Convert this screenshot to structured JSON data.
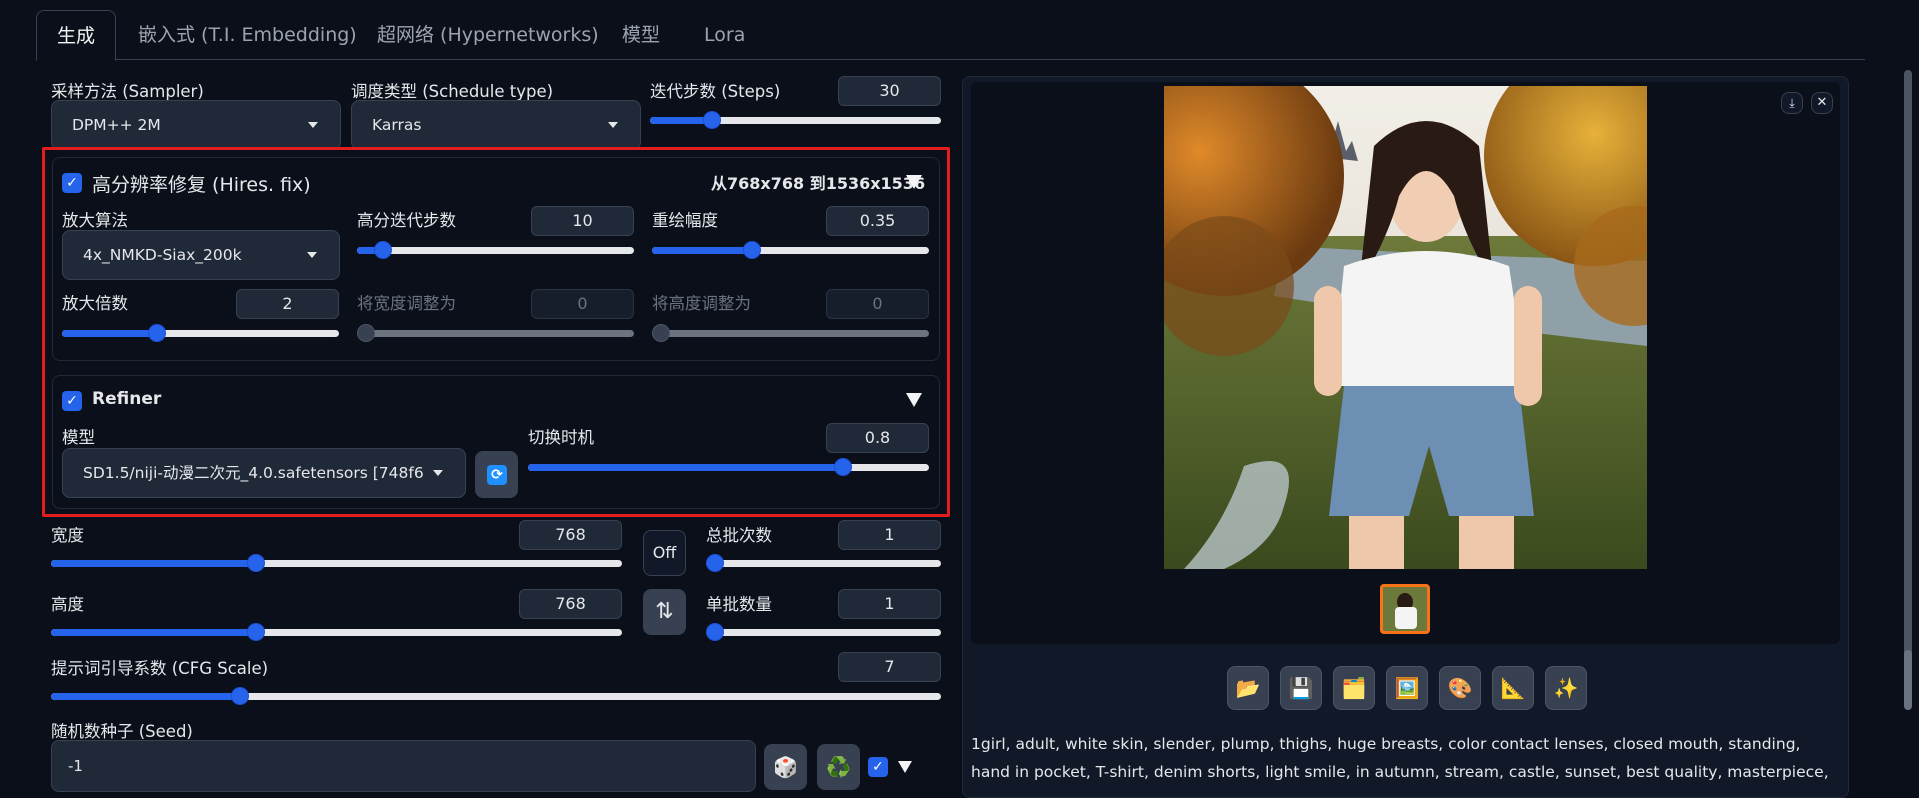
{
  "tabs": [
    {
      "label": "生成",
      "selected": true
    },
    {
      "label": "嵌入式 (T.I. Embedding)"
    },
    {
      "label": "超网络 (Hypernetworks)"
    },
    {
      "label": "模型"
    },
    {
      "label": "Lora"
    }
  ],
  "sampler": {
    "label": "采样方法 (Sampler)",
    "value": "DPM++ 2M"
  },
  "schedule": {
    "label": "调度类型 (Schedule type)",
    "value": "Karras"
  },
  "steps": {
    "label": "迭代步数 (Steps)",
    "value": "30",
    "min": 1,
    "max": 150,
    "v": 30
  },
  "hires": {
    "title": "高分辨率修复 (Hires. fix)",
    "summary": "从768x768 到1536x1536",
    "upscaler": {
      "label": "放大算法",
      "value": "4x_NMKD-Siax_200k"
    },
    "hires_steps": {
      "label": "高分迭代步数",
      "value": "10",
      "min": 0,
      "max": 150,
      "v": 10
    },
    "denoise": {
      "label": "重绘幅度",
      "value": "0.35",
      "min": 0,
      "max": 1,
      "v": 0.35
    },
    "upscale_by": {
      "label": "放大倍数",
      "value": "2",
      "min": 1,
      "max": 4,
      "v": 2
    },
    "resize_w": {
      "label": "将宽度调整为",
      "value": "0"
    },
    "resize_h": {
      "label": "将高度调整为",
      "value": "0"
    }
  },
  "refiner": {
    "title": "Refiner",
    "model": {
      "label": "模型",
      "value": "SD1.5/niji-动漫二次元_4.0.safetensors [748f6"
    },
    "switch_at": {
      "label": "切换时机",
      "value": "0.8",
      "min": 0.01,
      "max": 1,
      "v": 0.8
    }
  },
  "width": {
    "label": "宽度",
    "value": "768",
    "min": 64,
    "max": 2048,
    "v": 768
  },
  "height": {
    "label": "高度",
    "value": "768",
    "min": 64,
    "max": 2048,
    "v": 768
  },
  "off_label": "Off",
  "batch_count": {
    "label": "总批次数",
    "value": "1"
  },
  "batch_size": {
    "label": "单批数量",
    "value": "1"
  },
  "cfg": {
    "label": "提示词引导系数 (CFG Scale)",
    "value": "7",
    "min": 1,
    "max": 30,
    "v": 7
  },
  "seed": {
    "label": "随机数种子 (Seed)",
    "value": "-1"
  },
  "icons": {
    "dice": "🎲",
    "recycle": "♻️",
    "tools": [
      "📂",
      "💾",
      "🗂️",
      "🖼️",
      "🎨",
      "📐",
      "✨"
    ]
  },
  "prompt_text": "1girl, adult, white skin, slender, plump, thighs, huge breasts, color contact lenses, closed mouth, standing, hand in pocket, T-shirt, denim shorts, light smile, in autumn, stream, castle, sunset, best quality, masterpiece, Highly detailed,",
  "colors": {
    "accent": "#2563eb",
    "highlight": "#e11d1d",
    "thumb_border": "#f97316"
  }
}
